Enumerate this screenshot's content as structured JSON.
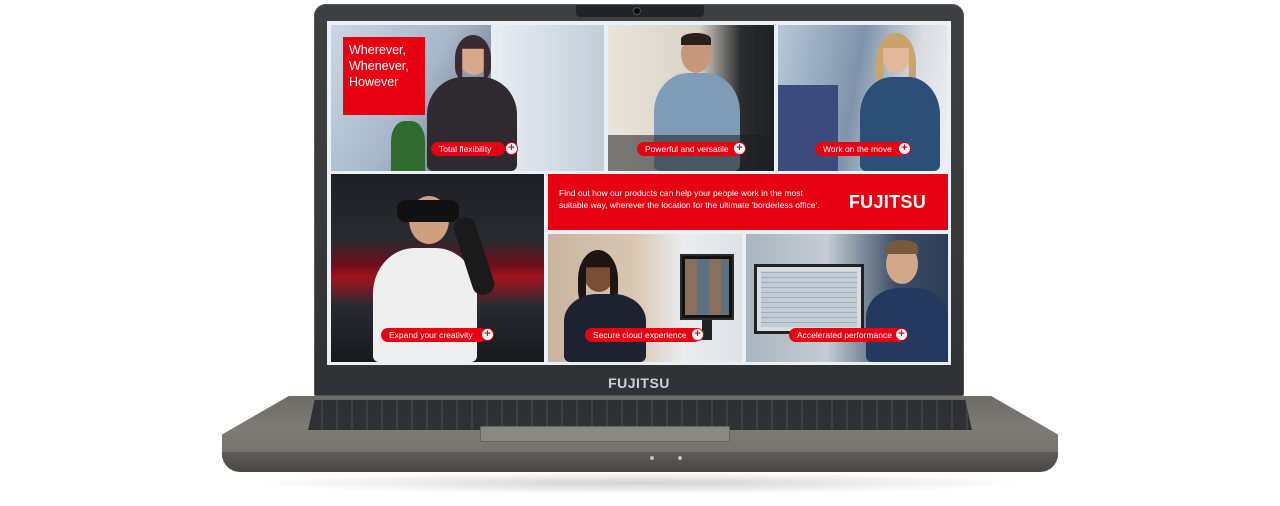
{
  "hero": {
    "headline_lines": [
      "Wherever,",
      "Whenever,",
      "However"
    ]
  },
  "tiles": [
    {
      "label": "Total flexibility"
    },
    {
      "label": "Powerful and versatile"
    },
    {
      "label": "Work on the move"
    },
    {
      "label": "Expand your creativity"
    },
    {
      "label": "Secure cloud experience"
    },
    {
      "label": "Accelerated performance"
    }
  ],
  "banner": {
    "text": "Find out how our products can help your people work in the most suitable way, wherever the location for the ultimate 'borderless office'.",
    "logo": "FUJITSU"
  },
  "bezel": {
    "logo": "FUJITSU"
  },
  "icons": {
    "expand": "plus-circle-icon"
  },
  "colors": {
    "brand_red": "#e60012",
    "bezel": "#3a3c3e",
    "chassis": "#74726d"
  }
}
